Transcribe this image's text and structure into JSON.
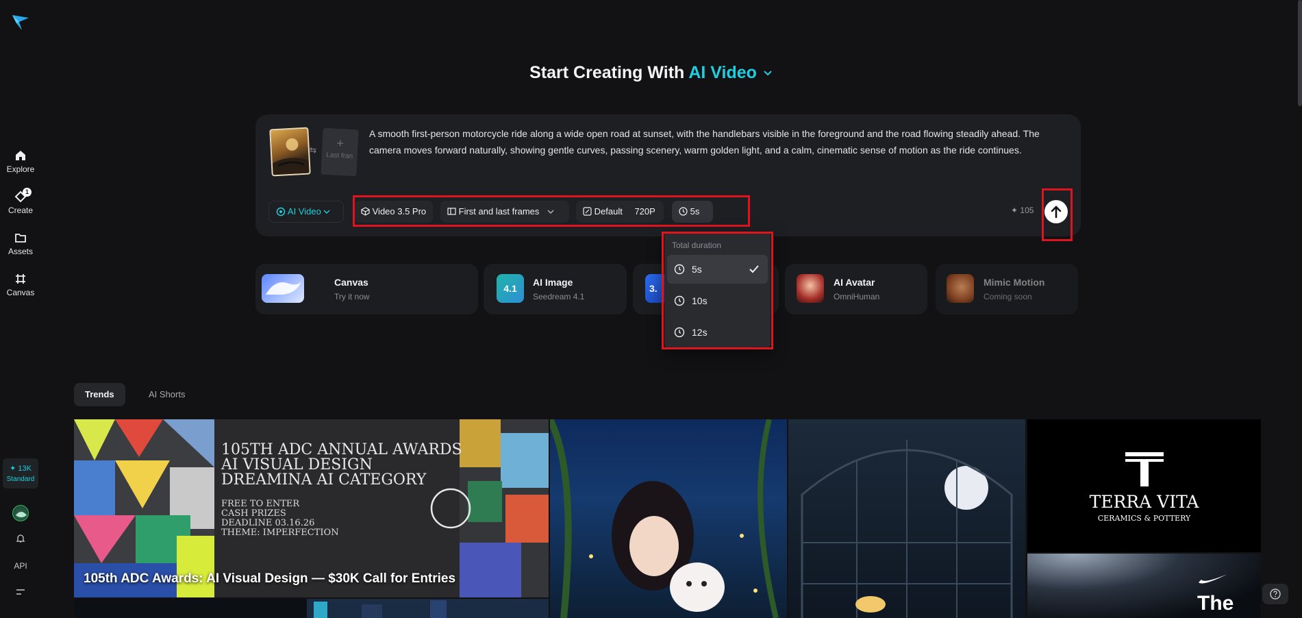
{
  "nav": {
    "items": [
      {
        "label": "Explore",
        "icon": "home-icon"
      },
      {
        "label": "Create",
        "icon": "create-icon",
        "badge": "1"
      },
      {
        "label": "Assets",
        "icon": "folder-icon"
      },
      {
        "label": "Canvas",
        "icon": "canvas-icon"
      }
    ],
    "credits": "✦ 13K",
    "tier": "Standard",
    "api_label": "API"
  },
  "headline": {
    "prefix": "Start Creating With ",
    "accent": "AI Video"
  },
  "prompt": {
    "last_frame_label": "Last fran",
    "text": "A smooth first-person motorcycle ride along a wide open road at sunset, with the handlebars visible in the foreground and the road flowing steadily ahead. The camera moves forward naturally, showing gentle curves, passing scenery, warm golden light, and a calm, cinematic sense of motion as the ride continues."
  },
  "toolbar": {
    "mode": "AI Video",
    "model": "Video 3.5 Pro",
    "frames": "First and last frames",
    "aspect": "Default",
    "resolution": "720P",
    "duration": "5s",
    "cost": "✦ 105"
  },
  "duration_menu": {
    "title": "Total duration",
    "options": [
      "5s",
      "10s",
      "12s"
    ],
    "selected": "5s"
  },
  "tools": [
    {
      "title": "Canvas",
      "sub": "Try it now"
    },
    {
      "title": "AI Image",
      "sub": "Seedream 4.1",
      "thumb_text": "4.1"
    },
    {
      "title": "",
      "sub": "",
      "thumb_text": "3."
    },
    {
      "title": "AI Avatar",
      "sub": "OmniHuman"
    },
    {
      "title": "Mimic Motion",
      "sub": "Coming soon"
    }
  ],
  "tabs": [
    "Trends",
    "AI Shorts"
  ],
  "feed": {
    "banner_lines": [
      "105TH ADC ANNUAL AWARDS",
      "AI VISUAL DESIGN",
      "DREAMINA AI CATEGORY"
    ],
    "banner_small": [
      "FREE TO ENTER",
      "CASH PRIZES",
      "DEADLINE 03.16.26",
      "THEME: IMPERFECTION"
    ],
    "banner_caption": "105th ADC Awards: AI Visual Design — $30K Call for Entries",
    "terra_title": "TERRA VITA",
    "terra_sub": "CERAMICS & POTTERY",
    "nike_text": "The"
  },
  "colors": {
    "accent": "#1fcfe0",
    "highlight": "#e0141f",
    "background": "#121214"
  }
}
